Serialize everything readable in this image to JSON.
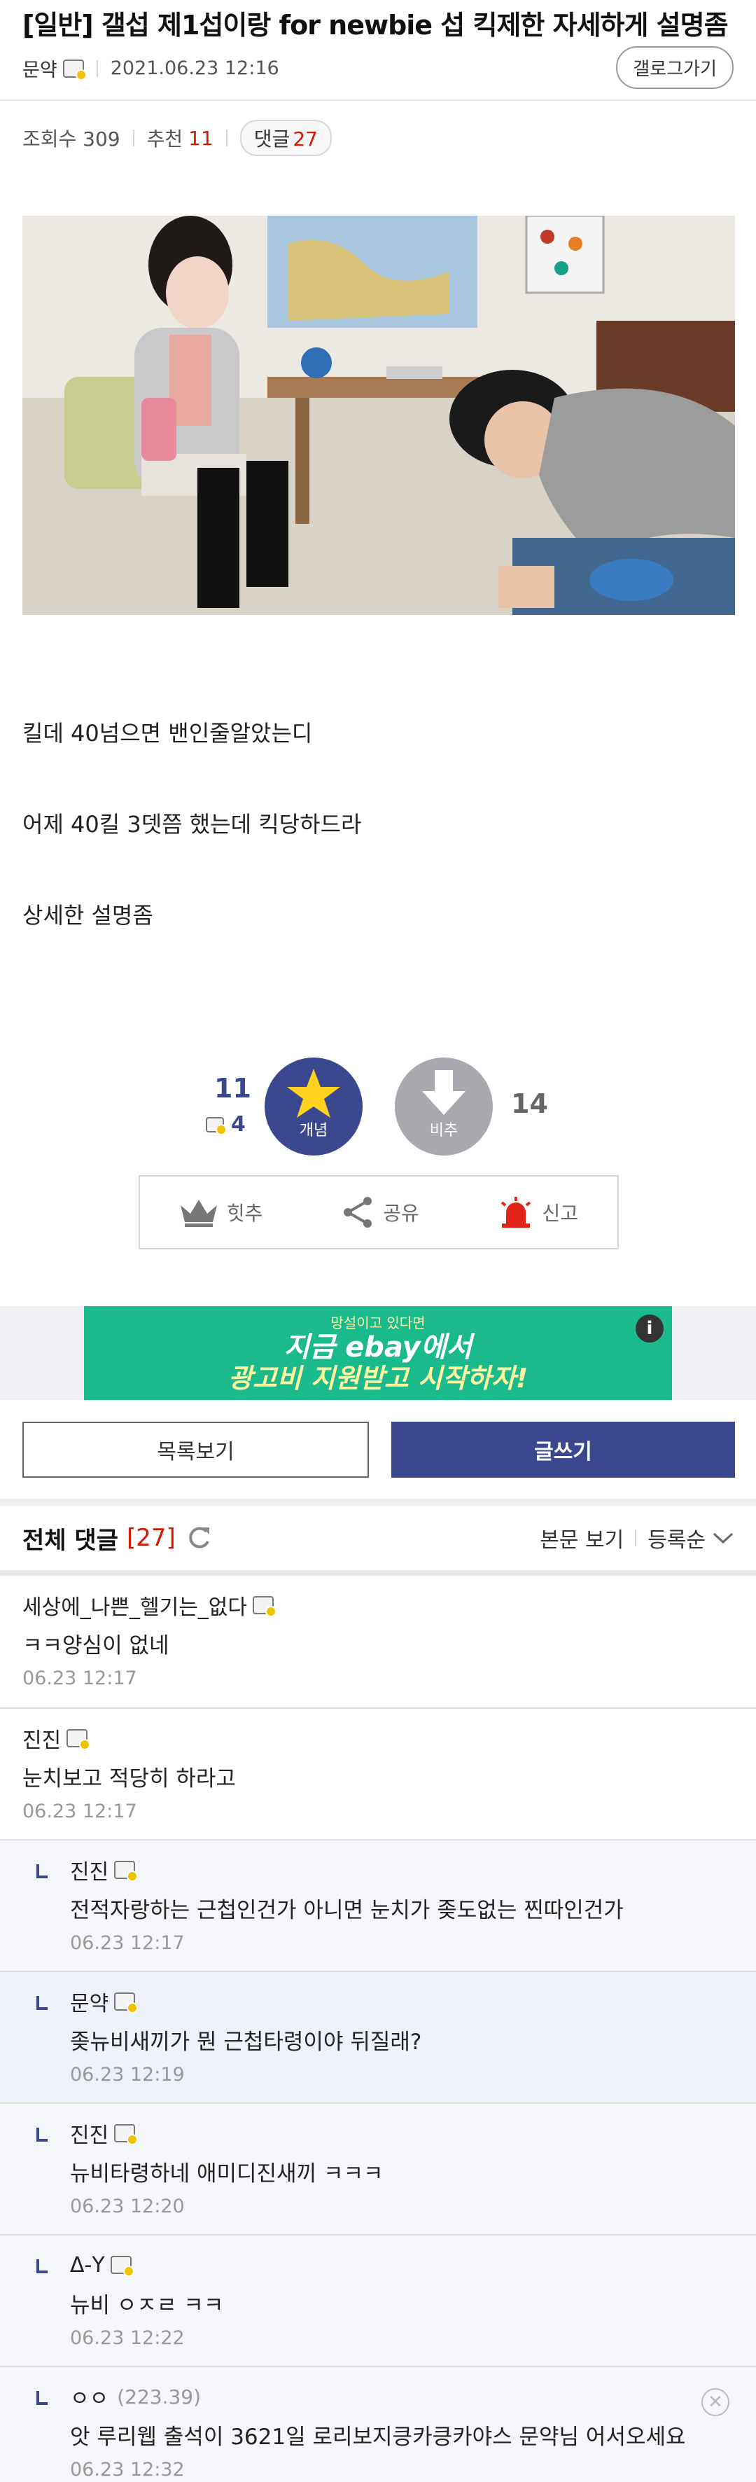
{
  "post": {
    "title": "[일반] 갤섭 제1섭이랑 for newbie 섭 킥제한 자세하게 설명좀",
    "author": "문약",
    "date": "2021.06.23 12:16",
    "gallog_button": "갤로그가기",
    "views_label": "조회수 309",
    "recommend_label": "추천",
    "recommend_value": "11",
    "reply_label": "댓글",
    "reply_value": "27",
    "body": [
      "킬데 40넘으면 밴인줄알았는디",
      "어제 40킬 3뎃쯤 했는데 킥당하드라",
      "상세한 설명좀"
    ]
  },
  "vote": {
    "up_count": "11",
    "up_fixed_count": "4",
    "up_label": "개념",
    "down_label": "비추",
    "down_count": "14",
    "colors": {
      "up": "#3b4890",
      "down": "#a8a8ae"
    }
  },
  "actions": {
    "hit": "힛추",
    "share": "공유",
    "report": "신고"
  },
  "ad": {
    "line1": "망설이고 있다면",
    "line2": "지금 ebay에서",
    "line3": "광고비 지원받고 시작하자!",
    "info": "i"
  },
  "buttons": {
    "list": "목록보기",
    "write": "글쓰기"
  },
  "comments_header": {
    "title": "전체 댓글",
    "count": "[27]",
    "view_body": "본문 보기",
    "sort": "등록순"
  },
  "comments": [
    {
      "nick": "세상에_나쁜_헬기는_없다",
      "ip": "",
      "text": "ㅋㅋ양심이 없네",
      "date": "06.23 12:17"
    },
    {
      "nick": "진진",
      "ip": "",
      "text": "눈치보고 적당히 하라고",
      "date": "06.23 12:17"
    },
    {
      "nick": "진진",
      "ip": "",
      "text": "전적자랑하는 근첩인건가 아니면 눈치가 좆도없는 찐따인건가",
      "date": "06.23 12:17"
    },
    {
      "nick": "문약",
      "ip": "",
      "text": "좆뉴비새끼가 뭔 근첩타령이야 뒤질래?",
      "date": "06.23 12:19"
    },
    {
      "nick": "진진",
      "ip": "",
      "text": "뉴비타령하네 애미디진새끼 ㅋㅋㅋ",
      "date": "06.23 12:20"
    },
    {
      "nick": "Δ-Y",
      "ip": "",
      "text": "뉴비 ㅇㅈㄹ ㅋㅋ",
      "date": "06.23 12:22"
    },
    {
      "nick": "ㅇㅇ",
      "ip": "(223.39)",
      "text": "앗 루리웹 출석이 3621일 로리보지킁카킁카야스 문약님 어서오세요",
      "date": "06.23 12:32",
      "delete": "✕"
    }
  ]
}
